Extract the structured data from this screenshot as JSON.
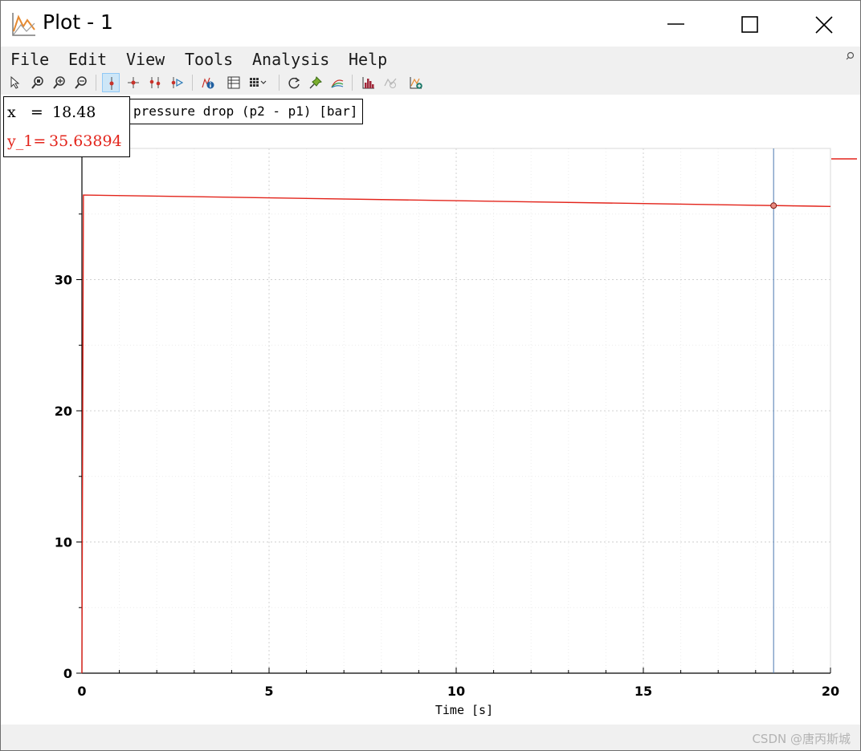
{
  "window": {
    "title": "Plot - 1"
  },
  "menu": [
    "File",
    "Edit",
    "View",
    "Tools",
    "Analysis",
    "Help"
  ],
  "toolbar": {
    "icons": [
      "select-icon",
      "zoom-region-icon",
      "zoom-in-icon",
      "zoom-out-icon",
      "cursor-icon",
      "crosshair-icon",
      "two-cursors-icon",
      "cursor-play-icon",
      "plot-info-icon",
      "data-table-icon",
      "grid-layout-icon",
      "refresh-icon",
      "pin-marker-icon",
      "curves-icon",
      "histogram-icon",
      "fit-icon",
      "new-plot-icon"
    ],
    "active": "cursor-icon"
  },
  "legend": {
    "text": "pressure drop (p2 - p1) [bar]",
    "color": "#e3241b"
  },
  "readout": {
    "x_label": "x   =",
    "x_value": "18.48",
    "y_label": "y_1=",
    "y_value": "35.63894"
  },
  "colors": {
    "series": "#e3241b",
    "cursor": "#4a78b0"
  },
  "chart_data": {
    "type": "line",
    "xlabel": "Time [s]",
    "ylabel": "",
    "xlim": [
      0,
      20
    ],
    "ylim": [
      0,
      40
    ],
    "xticks": [
      0,
      5,
      10,
      15,
      20
    ],
    "yticks": [
      0,
      10,
      20,
      30
    ],
    "grid": true,
    "series": [
      {
        "name": "pressure drop (p2 - p1) [bar]",
        "x": [
          0,
          0.04,
          20
        ],
        "y": [
          0,
          36.45,
          35.58
        ]
      }
    ],
    "cursor": {
      "x": 18.48,
      "y": 35.63894
    }
  },
  "footer": {
    "watermark": "CSDN @唐丙斯城"
  }
}
